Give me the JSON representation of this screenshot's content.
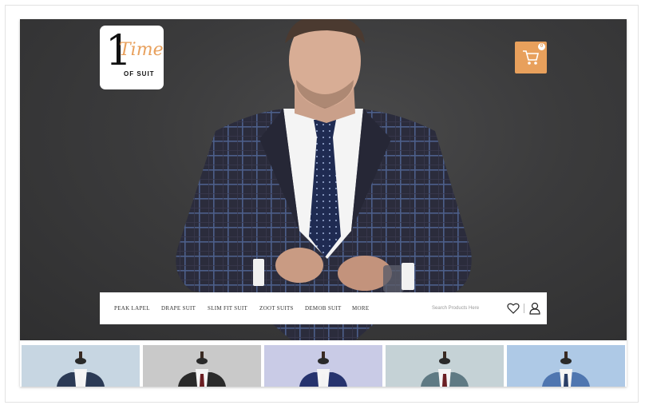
{
  "brand": {
    "number": "1",
    "script": "Time",
    "sub": "OF SUIT"
  },
  "cart": {
    "count": "0"
  },
  "nav": {
    "items": [
      "PEAK LAPEL",
      "DRAPE SUIT",
      "SLIM FIT SUIT",
      "ZOOT SUITS",
      "DEMOB SUIT",
      "MORE"
    ],
    "search_placeholder": "Search Products Here"
  },
  "colors": {
    "accent": "#e8a05c",
    "hero_bg": "#3a3a3b"
  },
  "icons": [
    "cart-icon",
    "heart-icon",
    "user-icon"
  ],
  "products": [
    {
      "bg": "#c7d6e2",
      "suit": "#2b3a55",
      "tie": "#f3f3f3"
    },
    {
      "bg": "#c9c9c9",
      "suit": "#2a2a2a",
      "tie": "#6b1e22"
    },
    {
      "bg": "#c9cbe6",
      "suit": "#26336e",
      "tie": "#f3f3f3"
    },
    {
      "bg": "#c5d2d6",
      "suit": "#5f7a84",
      "tie": "#6b1e22"
    },
    {
      "bg": "#aec9e6",
      "suit": "#4f76b0",
      "tie": "#2a3e66"
    }
  ]
}
